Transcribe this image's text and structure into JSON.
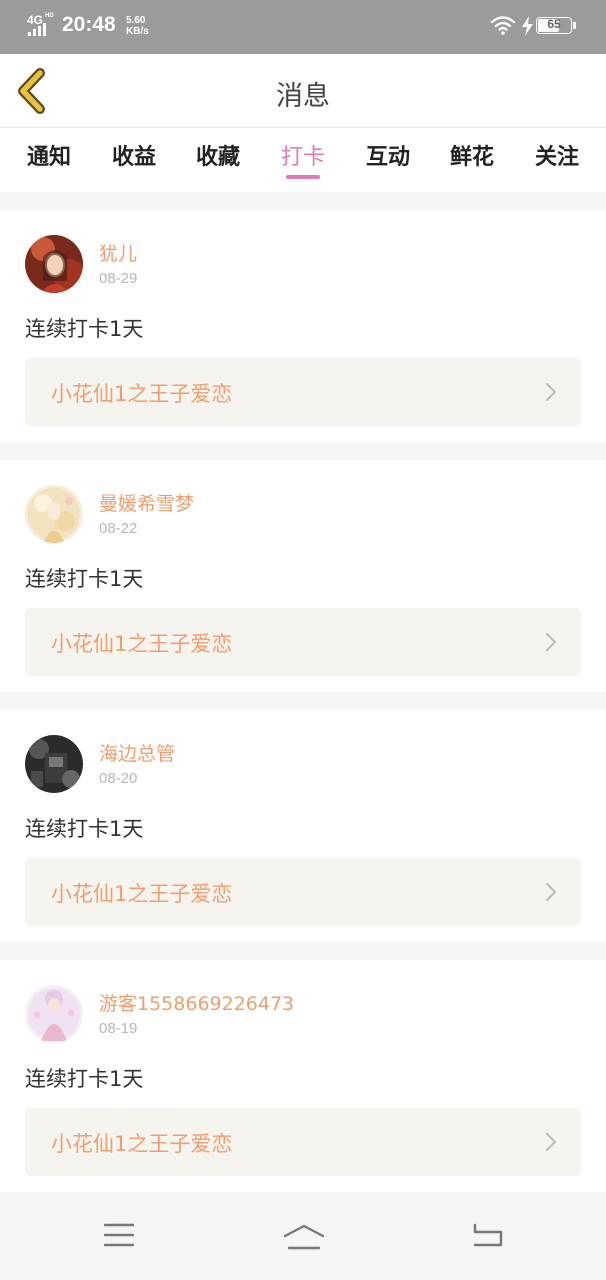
{
  "statusbar": {
    "network": "4G",
    "network_sub": "HD",
    "time": "20:48",
    "speed_value": "5.60",
    "speed_unit": "KB/s",
    "battery": "65",
    "battery_level": 0.65
  },
  "header": {
    "title": "消息",
    "back_icon": "chevron-left-icon"
  },
  "tabs": [
    {
      "label": "通知",
      "active": false
    },
    {
      "label": "收益",
      "active": false
    },
    {
      "label": "收藏",
      "active": false
    },
    {
      "label": "打卡",
      "active": true
    },
    {
      "label": "互动",
      "active": false
    },
    {
      "label": "鲜花",
      "active": false
    },
    {
      "label": "关注",
      "active": false
    }
  ],
  "messages": [
    {
      "name": "犹儿",
      "date": "08-29",
      "text": "连续打卡1天",
      "book": "小花仙1之王子爱恋"
    },
    {
      "name": "曼媛希雪梦",
      "date": "08-22",
      "text": "连续打卡1天",
      "book": "小花仙1之王子爱恋"
    },
    {
      "name": "海边总管",
      "date": "08-20",
      "text": "连续打卡1天",
      "book": "小花仙1之王子爱恋"
    },
    {
      "name": "游客1558669226473",
      "date": "08-19",
      "text": "连续打卡1天",
      "book": "小花仙1之王子爱恋"
    }
  ],
  "colors": {
    "accent": "#e07ab8",
    "name_color": "#ef9f6f",
    "back_icon": "#e7c23a"
  },
  "navbar": {
    "menu_icon": "menu-icon",
    "home_icon": "home-icon",
    "back_icon": "return-icon"
  }
}
